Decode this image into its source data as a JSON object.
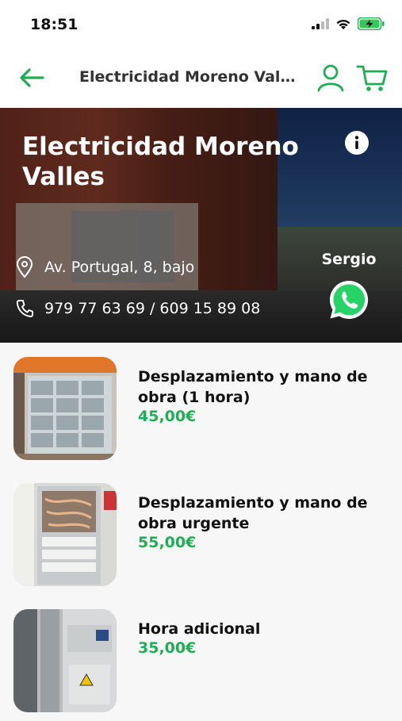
{
  "status": {
    "time": "18:51"
  },
  "nav": {
    "title": "Electricidad Moreno Valles",
    "accent": "#1fae55"
  },
  "business": {
    "name": "Electricidad Moreno Valles",
    "address": "Av. Portugal, 8, bajo",
    "phone": "979 77 63 69 / 609 15 89 08",
    "contact_name": "Sergio"
  },
  "items": [
    {
      "title": "Desplazamiento y mano de obra (1 hora)",
      "price": "45,00€"
    },
    {
      "title": "Desplazamiento y mano de obra urgente",
      "price": "55,00€"
    },
    {
      "title": "Hora adicional",
      "price": "35,00€"
    }
  ]
}
